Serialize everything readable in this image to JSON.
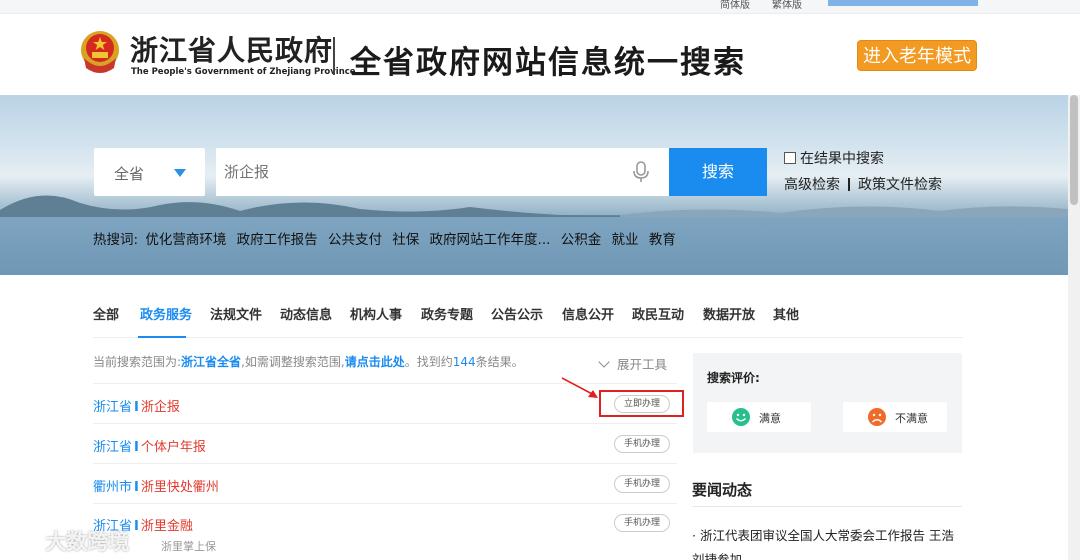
{
  "topbar": {
    "link_a": "简体版",
    "link_b": "繁体版"
  },
  "header": {
    "logo_cn": "浙江省人民政府",
    "logo_en": "The People's Government of Zhejiang Province",
    "title": "全省政府网站信息统一搜索",
    "elder_mode": "进入老年模式"
  },
  "search": {
    "region": "全省",
    "placeholder": "浙企报",
    "button": "搜索",
    "in_results": "在结果中搜索",
    "advanced": "高级检索",
    "policy": "政策文件检索"
  },
  "hot": {
    "label": "热搜词:",
    "items": [
      "优化营商环境",
      "政府工作报告",
      "公共支付",
      "社保",
      "政府网站工作年度...",
      "公积金",
      "就业",
      "教育"
    ]
  },
  "tabs": [
    "全部",
    "政务服务",
    "法规文件",
    "动态信息",
    "机构人事",
    "政务专题",
    "公告公示",
    "信息公开",
    "政民互动",
    "数据开放",
    "其他"
  ],
  "scope": {
    "prefix": "当前搜索范围为:",
    "region": "浙江省全省",
    "middle": ",如需调整搜索范围,",
    "link": "请点击此处",
    "found_prefix": "。找到约",
    "count": "144",
    "found_suffix": "条结果。"
  },
  "expand_tools": "展开工具",
  "results": [
    {
      "region": "浙江省",
      "sep": "I",
      "name": "浙企报",
      "action": "立即办理"
    },
    {
      "region": "浙江省",
      "sep": "I",
      "name": "个体户年报",
      "action": "手机办理"
    },
    {
      "region": "衢州市",
      "sep": "I",
      "name": "浙里快处衢州",
      "action": "手机办理"
    },
    {
      "region": "浙江省",
      "sep": "I",
      "name": "浙里金融",
      "action": "手机办理"
    }
  ],
  "row4_meta": "浙里掌上保",
  "evaluation": {
    "title": "搜索评价:",
    "satisfied": "满意",
    "unsatisfied": "不满意"
  },
  "news": {
    "heading": "要闻动态",
    "item": "· 浙江代表团审议全国人大常委会工作报告 王浩刘捷参加"
  },
  "watermark": "大数跨境",
  "colors": {
    "accent": "#1a8cf0",
    "highlight_red": "#e23a2e",
    "elder_orange": "#f39a22"
  }
}
